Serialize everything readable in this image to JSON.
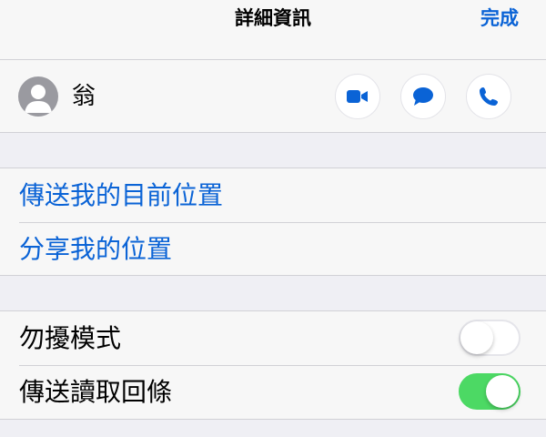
{
  "navbar": {
    "title": "詳細資訊",
    "done_label": "完成"
  },
  "contact": {
    "name": "翁",
    "avatar_icon": "person-silhouette-icon",
    "actions": [
      {
        "icon": "video-camera-icon"
      },
      {
        "icon": "message-bubble-icon"
      },
      {
        "icon": "phone-icon"
      }
    ]
  },
  "location": {
    "send_current_label": "傳送我的目前位置",
    "share_label": "分享我的位置"
  },
  "settings": {
    "dnd_label": "勿擾模式",
    "dnd_on": false,
    "read_receipts_label": "傳送讀取回條",
    "read_receipts_on": true
  },
  "colors": {
    "accent": "#0a63d6",
    "toggle_on": "#4cd964",
    "background": "#efeff4"
  }
}
